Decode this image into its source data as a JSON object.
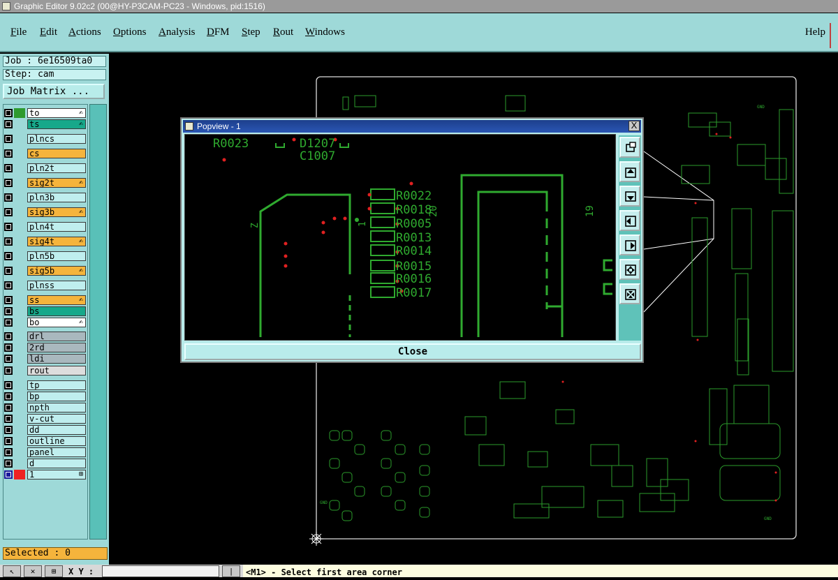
{
  "window": {
    "title": "Graphic Editor 9.02c2 (00@HY-P3CAM-PC23 - Windows, pid:1516)"
  },
  "menu": {
    "items": [
      {
        "first": "F",
        "rest": "ile"
      },
      {
        "first": "E",
        "rest": "dit"
      },
      {
        "first": "A",
        "rest": "ctions"
      },
      {
        "first": "O",
        "rest": "ptions"
      },
      {
        "first": "A",
        "rest": "nalysis"
      },
      {
        "first": "D",
        "rest": "FM"
      },
      {
        "first": "S",
        "rest": "tep"
      },
      {
        "first": "R",
        "rest": "out"
      },
      {
        "first": "W",
        "rest": "indows"
      }
    ],
    "help": "Help"
  },
  "sidebar": {
    "job": "Job : 6e16509ta0",
    "step": "Step: cam",
    "job_matrix": "Job Matrix ...",
    "layers": [
      {
        "name": "to",
        "color": "#ffffff",
        "swatch": "#2e9a2e",
        "mark": true
      },
      {
        "name": "ts",
        "color": "#17a88a",
        "swatch": "",
        "mark": true
      },
      {
        "name": "plncs",
        "color": "#bfeeee",
        "swatch": "",
        "mark": false
      },
      {
        "name": "cs",
        "color": "#f5b43c",
        "swatch": "",
        "mark": false
      },
      {
        "name": "pln2t",
        "color": "#bfeeee",
        "swatch": "",
        "mark": false
      },
      {
        "name": "sig2t",
        "color": "#f5b43c",
        "swatch": "",
        "mark": true
      },
      {
        "name": "pln3b",
        "color": "#bfeeee",
        "swatch": "",
        "mark": false
      },
      {
        "name": "sig3b",
        "color": "#f5b43c",
        "swatch": "",
        "mark": true
      },
      {
        "name": "pln4t",
        "color": "#bfeeee",
        "swatch": "",
        "mark": false
      },
      {
        "name": "sig4t",
        "color": "#f5b43c",
        "swatch": "",
        "mark": true
      },
      {
        "name": "pln5b",
        "color": "#bfeeee",
        "swatch": "",
        "mark": false
      },
      {
        "name": "sig5b",
        "color": "#f5b43c",
        "swatch": "",
        "mark": true
      },
      {
        "name": "plnss",
        "color": "#bfeeee",
        "swatch": "",
        "mark": false
      },
      {
        "name": "ss",
        "color": "#f5b43c",
        "swatch": "",
        "mark": true
      },
      {
        "name": "bs",
        "color": "#17a88a",
        "swatch": "",
        "mark": false
      },
      {
        "name": "bo",
        "color": "#ffffff",
        "swatch": "",
        "mark": true
      },
      {
        "name": "drl",
        "color": "#a9b8be",
        "swatch": "",
        "mark": false
      },
      {
        "name": "2rd",
        "color": "#a9b8be",
        "swatch": "",
        "mark": false
      },
      {
        "name": "ldi",
        "color": "#a9b8be",
        "swatch": "",
        "mark": false
      },
      {
        "name": "rout",
        "color": "#dddddd",
        "swatch": "",
        "mark": false
      },
      {
        "name": "tp",
        "color": "#bfeeee",
        "swatch": "",
        "mark": false
      },
      {
        "name": "bp",
        "color": "#bfeeee",
        "swatch": "",
        "mark": false
      },
      {
        "name": "npth",
        "color": "#bfeeee",
        "swatch": "",
        "mark": false
      },
      {
        "name": "v-cut",
        "color": "#bfeeee",
        "swatch": "",
        "mark": false
      },
      {
        "name": "dd",
        "color": "#bfeeee",
        "swatch": "",
        "mark": false
      },
      {
        "name": "outline",
        "color": "#bfeeee",
        "swatch": "",
        "mark": false
      },
      {
        "name": "panel",
        "color": "#bfeeee",
        "swatch": "",
        "mark": false
      },
      {
        "name": "d",
        "color": "#bfeeee",
        "swatch": "",
        "mark": false
      },
      {
        "name": "1",
        "color": "#bfeeee",
        "swatch": "#ee2222",
        "mark": false
      }
    ],
    "selected": "Selected : 0"
  },
  "popview": {
    "title": "Popview - 1",
    "close_x": "X",
    "close_button": "Close",
    "refs": {
      "r0023": "R0023",
      "d1207": "D1207",
      "c1007": "C1007",
      "r0022": "R0022",
      "r0018": "R0018",
      "r0005": "R0005",
      "r0013": "R0013",
      "r0014": "R0014",
      "r0015": "R0015",
      "r0016": "R0016",
      "r0017": "R0017",
      "n20": "20",
      "n19": "19",
      "n1": "1",
      "z": "Z"
    }
  },
  "board": {
    "gnd_top": "GND",
    "gnd_left": "GND",
    "gnd_bottom": "GND"
  },
  "status": {
    "xy_label": "X Y :",
    "xy_value": "",
    "message": "<M1> - Select first area corner"
  }
}
